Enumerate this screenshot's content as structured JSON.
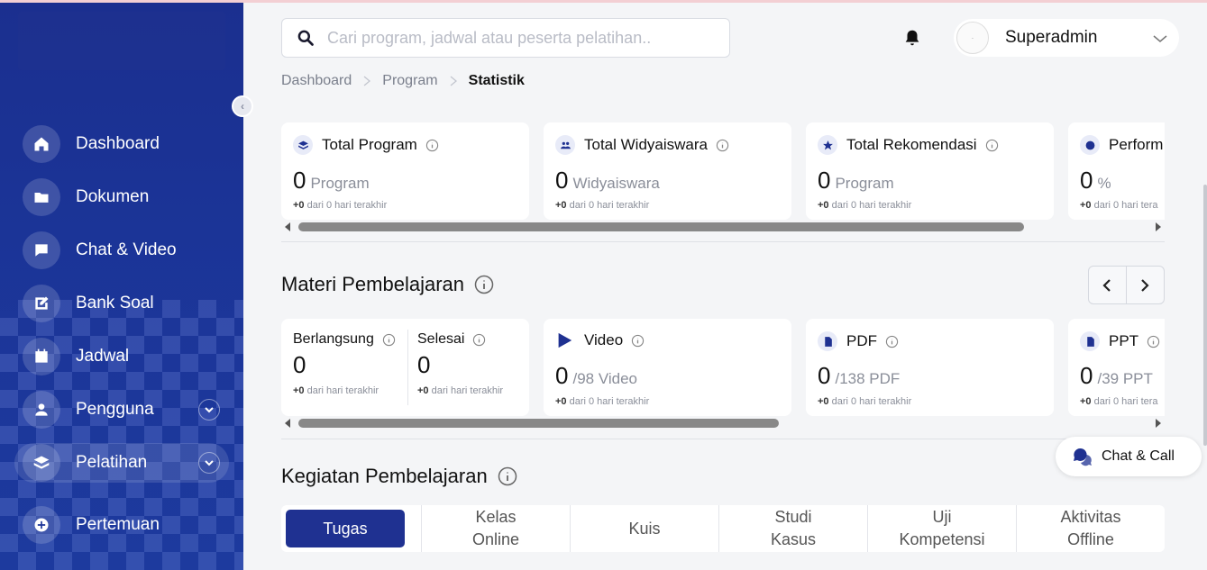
{
  "sidebar": {
    "items": [
      {
        "label": "Dashboard",
        "icon": "home-icon"
      },
      {
        "label": "Dokumen",
        "icon": "folder-icon"
      },
      {
        "label": "Chat & Video",
        "icon": "chat-icon"
      },
      {
        "label": "Bank Soal",
        "icon": "edit-icon"
      },
      {
        "label": "Jadwal",
        "icon": "calendar-icon"
      },
      {
        "label": "Pengguna",
        "icon": "users-icon"
      },
      {
        "label": "Pelatihan",
        "icon": "layers-icon"
      },
      {
        "label": "Pertemuan",
        "icon": "plus-circle-icon"
      }
    ]
  },
  "header": {
    "search_placeholder": "Cari program, jadwal atau peserta pelatihan..",
    "user_name": "Superadmin"
  },
  "breadcrumb": [
    "Dashboard",
    "Program",
    "Statistik"
  ],
  "stats": [
    {
      "title": "Total Program",
      "value": "0",
      "unit": "Program",
      "delta": "+0",
      "sub": " dari 0 hari terakhir"
    },
    {
      "title": "Total Widyaiswara",
      "value": "0",
      "unit": "Widyaiswara",
      "delta": "+0",
      "sub": " dari 0 hari terakhir"
    },
    {
      "title": "Total Rekomendasi",
      "value": "0",
      "unit": "Program",
      "delta": "+0",
      "sub": " dari 0 hari terakhir"
    },
    {
      "title": "Perform",
      "value": "0",
      "unit": "%",
      "delta": "+0",
      "sub": " dari 0 hari tera"
    }
  ],
  "materi": {
    "title": "Materi Pembelajaran",
    "berlangsung": {
      "label": "Berlangsung",
      "value": "0",
      "delta": "+0",
      "sub": " dari hari terakhir"
    },
    "selesai": {
      "label": "Selesai",
      "value": "0",
      "delta": "+0",
      "sub": " dari hari terakhir"
    },
    "cards": [
      {
        "title": "Video",
        "value": "0",
        "unit": "/98 Video",
        "delta": "+0",
        "sub": " dari 0 hari terakhir"
      },
      {
        "title": "PDF",
        "value": "0",
        "unit": "/138 PDF",
        "delta": "+0",
        "sub": " dari 0 hari terakhir"
      },
      {
        "title": "PPT",
        "value": "0",
        "unit": "/39 PPT",
        "delta": "+0",
        "sub": " dari 0 hari tera"
      }
    ]
  },
  "kegiatan": {
    "title": "Kegiatan Pembelajaran",
    "tabs": [
      "Tugas",
      "Kelas\nOnline",
      "Kuis",
      "Studi\nKasus",
      "Uji\nKompetensi",
      "Aktivitas\nOffline"
    ]
  },
  "chatcall": {
    "label": "Chat & Call"
  },
  "colors": {
    "primary": "#1f3191",
    "sidebar": "#1b3497"
  }
}
